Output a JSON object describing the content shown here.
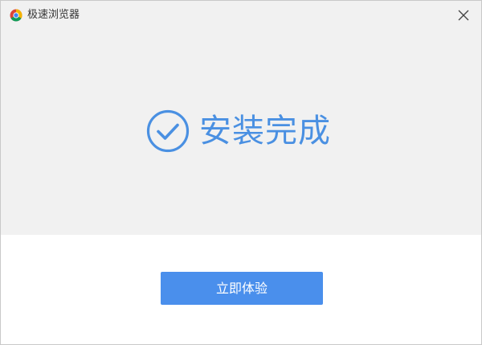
{
  "window": {
    "title": "极速浏览器"
  },
  "icons": {
    "app": "browser-logo-icon",
    "close": "close-icon",
    "status": "check-circle-icon"
  },
  "status": {
    "text": "安装完成"
  },
  "actions": {
    "primary_label": "立即体验"
  },
  "colors": {
    "accent": "#4a90e2",
    "button": "#4a8fec",
    "panel_background": "#f1f1f1"
  }
}
